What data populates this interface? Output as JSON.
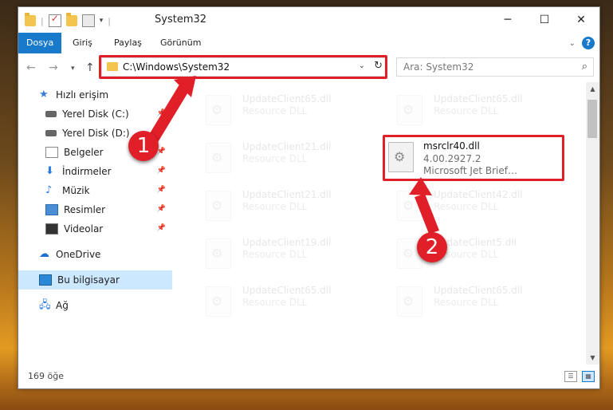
{
  "window": {
    "title": "System32",
    "controls": {
      "minimize": "─",
      "maximize": "☐",
      "close": "✕"
    }
  },
  "ribbon": {
    "tabs": [
      "Dosya",
      "Giriş",
      "Paylaş",
      "Görünüm"
    ],
    "active_tab": "Dosya"
  },
  "address": {
    "path": "C:\\Windows\\System32",
    "search_placeholder": "Ara: System32"
  },
  "sidebar": {
    "items": [
      {
        "label": "Hızlı erişim",
        "icon": "star-icon",
        "pinned": false
      },
      {
        "label": "Yerel Disk (C:)",
        "icon": "disk-icon",
        "pinned": true
      },
      {
        "label": "Yerel Disk (D:)",
        "icon": "disk-icon",
        "pinned": true
      },
      {
        "label": "Belgeler",
        "icon": "documents-icon",
        "pinned": true
      },
      {
        "label": "İndirmeler",
        "icon": "download-icon",
        "pinned": true
      },
      {
        "label": "Müzik",
        "icon": "music-icon",
        "pinned": true
      },
      {
        "label": "Resimler",
        "icon": "pictures-icon",
        "pinned": true
      },
      {
        "label": "Videolar",
        "icon": "videos-icon",
        "pinned": true
      },
      {
        "label": "OneDrive",
        "icon": "onedrive-icon",
        "pinned": false
      },
      {
        "label": "Bu bilgisayar",
        "icon": "this-pc-icon",
        "pinned": false,
        "selected": true
      },
      {
        "label": "Ağ",
        "icon": "network-icon",
        "pinned": false
      }
    ]
  },
  "files": [
    {
      "name": "UpdateClient65.dll",
      "desc": "Resource DLL"
    },
    {
      "name": "UpdateClient65.dll",
      "desc": "Resource DLL"
    },
    {
      "name": "UpdateClient21.dll",
      "desc": "Resource DLL"
    },
    {
      "name": "msrclr40.dll",
      "desc": "4.00.2927.2",
      "extra": "Microsoft Jet Brief…",
      "highlighted": true
    },
    {
      "name": "UpdateClient21.dll",
      "desc": "Resource DLL"
    },
    {
      "name": "UpdateClient42.dll",
      "desc": "Resource DLL"
    },
    {
      "name": "UpdateClient19.dll",
      "desc": "Resource DLL"
    },
    {
      "name": "UpdateClient5.dll",
      "desc": "Resource DLL"
    },
    {
      "name": "UpdateClient65.dll",
      "desc": "Resource DLL"
    },
    {
      "name": "UpdateClient65.dll",
      "desc": "Resource DLL"
    }
  ],
  "status": {
    "item_count": "169 öğe"
  },
  "annotations": {
    "step1": "1",
    "step2": "2",
    "color": "#e01f28"
  },
  "colors": {
    "accent": "#1979ca",
    "selection": "#cce8ff",
    "highlight": "#e01f28"
  }
}
